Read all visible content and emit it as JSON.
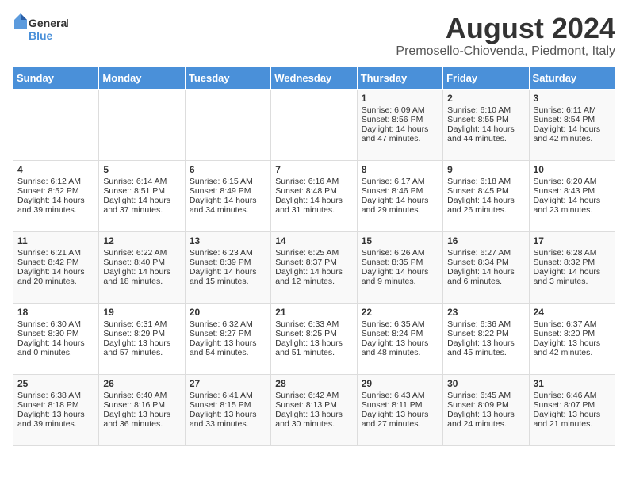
{
  "header": {
    "logo_general": "General",
    "logo_blue": "Blue",
    "month_year": "August 2024",
    "location": "Premosello-Chiovenda, Piedmont, Italy"
  },
  "days_of_week": [
    "Sunday",
    "Monday",
    "Tuesday",
    "Wednesday",
    "Thursday",
    "Friday",
    "Saturday"
  ],
  "weeks": [
    [
      {
        "day": "",
        "info": ""
      },
      {
        "day": "",
        "info": ""
      },
      {
        "day": "",
        "info": ""
      },
      {
        "day": "",
        "info": ""
      },
      {
        "day": "1",
        "info": "Sunrise: 6:09 AM\nSunset: 8:56 PM\nDaylight: 14 hours and 47 minutes."
      },
      {
        "day": "2",
        "info": "Sunrise: 6:10 AM\nSunset: 8:55 PM\nDaylight: 14 hours and 44 minutes."
      },
      {
        "day": "3",
        "info": "Sunrise: 6:11 AM\nSunset: 8:54 PM\nDaylight: 14 hours and 42 minutes."
      }
    ],
    [
      {
        "day": "4",
        "info": "Sunrise: 6:12 AM\nSunset: 8:52 PM\nDaylight: 14 hours and 39 minutes."
      },
      {
        "day": "5",
        "info": "Sunrise: 6:14 AM\nSunset: 8:51 PM\nDaylight: 14 hours and 37 minutes."
      },
      {
        "day": "6",
        "info": "Sunrise: 6:15 AM\nSunset: 8:49 PM\nDaylight: 14 hours and 34 minutes."
      },
      {
        "day": "7",
        "info": "Sunrise: 6:16 AM\nSunset: 8:48 PM\nDaylight: 14 hours and 31 minutes."
      },
      {
        "day": "8",
        "info": "Sunrise: 6:17 AM\nSunset: 8:46 PM\nDaylight: 14 hours and 29 minutes."
      },
      {
        "day": "9",
        "info": "Sunrise: 6:18 AM\nSunset: 8:45 PM\nDaylight: 14 hours and 26 minutes."
      },
      {
        "day": "10",
        "info": "Sunrise: 6:20 AM\nSunset: 8:43 PM\nDaylight: 14 hours and 23 minutes."
      }
    ],
    [
      {
        "day": "11",
        "info": "Sunrise: 6:21 AM\nSunset: 8:42 PM\nDaylight: 14 hours and 20 minutes."
      },
      {
        "day": "12",
        "info": "Sunrise: 6:22 AM\nSunset: 8:40 PM\nDaylight: 14 hours and 18 minutes."
      },
      {
        "day": "13",
        "info": "Sunrise: 6:23 AM\nSunset: 8:39 PM\nDaylight: 14 hours and 15 minutes."
      },
      {
        "day": "14",
        "info": "Sunrise: 6:25 AM\nSunset: 8:37 PM\nDaylight: 14 hours and 12 minutes."
      },
      {
        "day": "15",
        "info": "Sunrise: 6:26 AM\nSunset: 8:35 PM\nDaylight: 14 hours and 9 minutes."
      },
      {
        "day": "16",
        "info": "Sunrise: 6:27 AM\nSunset: 8:34 PM\nDaylight: 14 hours and 6 minutes."
      },
      {
        "day": "17",
        "info": "Sunrise: 6:28 AM\nSunset: 8:32 PM\nDaylight: 14 hours and 3 minutes."
      }
    ],
    [
      {
        "day": "18",
        "info": "Sunrise: 6:30 AM\nSunset: 8:30 PM\nDaylight: 14 hours and 0 minutes."
      },
      {
        "day": "19",
        "info": "Sunrise: 6:31 AM\nSunset: 8:29 PM\nDaylight: 13 hours and 57 minutes."
      },
      {
        "day": "20",
        "info": "Sunrise: 6:32 AM\nSunset: 8:27 PM\nDaylight: 13 hours and 54 minutes."
      },
      {
        "day": "21",
        "info": "Sunrise: 6:33 AM\nSunset: 8:25 PM\nDaylight: 13 hours and 51 minutes."
      },
      {
        "day": "22",
        "info": "Sunrise: 6:35 AM\nSunset: 8:24 PM\nDaylight: 13 hours and 48 minutes."
      },
      {
        "day": "23",
        "info": "Sunrise: 6:36 AM\nSunset: 8:22 PM\nDaylight: 13 hours and 45 minutes."
      },
      {
        "day": "24",
        "info": "Sunrise: 6:37 AM\nSunset: 8:20 PM\nDaylight: 13 hours and 42 minutes."
      }
    ],
    [
      {
        "day": "25",
        "info": "Sunrise: 6:38 AM\nSunset: 8:18 PM\nDaylight: 13 hours and 39 minutes."
      },
      {
        "day": "26",
        "info": "Sunrise: 6:40 AM\nSunset: 8:16 PM\nDaylight: 13 hours and 36 minutes."
      },
      {
        "day": "27",
        "info": "Sunrise: 6:41 AM\nSunset: 8:15 PM\nDaylight: 13 hours and 33 minutes."
      },
      {
        "day": "28",
        "info": "Sunrise: 6:42 AM\nSunset: 8:13 PM\nDaylight: 13 hours and 30 minutes."
      },
      {
        "day": "29",
        "info": "Sunrise: 6:43 AM\nSunset: 8:11 PM\nDaylight: 13 hours and 27 minutes."
      },
      {
        "day": "30",
        "info": "Sunrise: 6:45 AM\nSunset: 8:09 PM\nDaylight: 13 hours and 24 minutes."
      },
      {
        "day": "31",
        "info": "Sunrise: 6:46 AM\nSunset: 8:07 PM\nDaylight: 13 hours and 21 minutes."
      }
    ]
  ]
}
